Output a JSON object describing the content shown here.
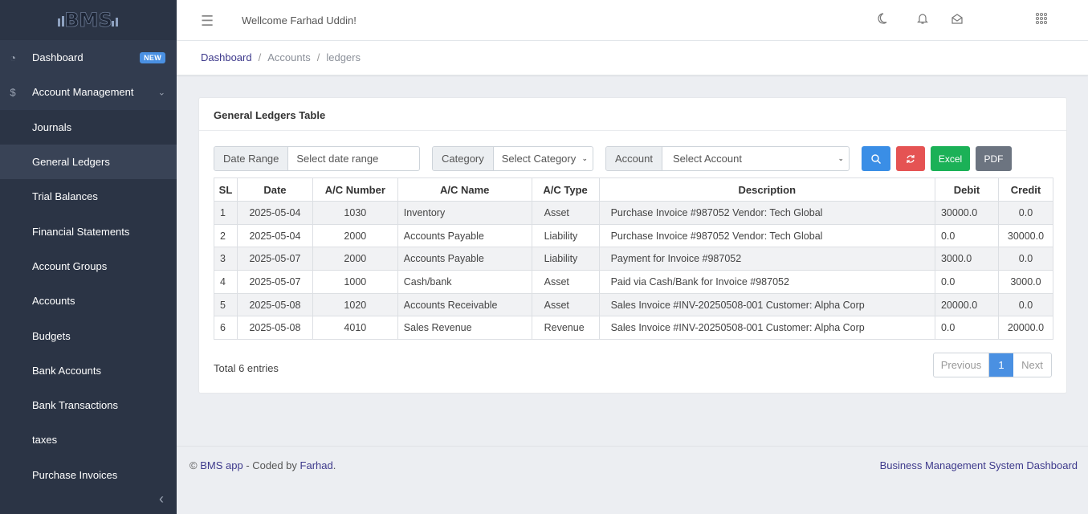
{
  "brand": {
    "logo_text": "BMS"
  },
  "sidebar": {
    "items": [
      {
        "label": "Dashboard",
        "icon": "speedometer-icon",
        "badge": "NEW"
      },
      {
        "label": "Account Management",
        "icon": "dollar-icon",
        "expandable": true
      },
      {
        "label": "Journals"
      },
      {
        "label": "General Ledgers",
        "active": true
      },
      {
        "label": "Trial Balances"
      },
      {
        "label": "Financial Statements"
      },
      {
        "label": "Account Groups"
      },
      {
        "label": "Accounts"
      },
      {
        "label": "Budgets"
      },
      {
        "label": "Bank Accounts"
      },
      {
        "label": "Bank Transactions"
      },
      {
        "label": "taxes"
      },
      {
        "label": "Purchase Invoices"
      }
    ]
  },
  "header": {
    "welcome": "Wellcome Farhad Uddin!"
  },
  "breadcrumb": {
    "items": [
      "Dashboard",
      "Accounts",
      "ledgers"
    ]
  },
  "card": {
    "title": "General Ledgers Table",
    "filters": {
      "date_label": "Date Range",
      "date_placeholder": "Select date range",
      "category_label": "Category",
      "category_value": "Select Category",
      "account_label": "Account",
      "account_value": "Select Account",
      "excel_label": "Excel",
      "pdf_label": "PDF"
    },
    "columns": [
      "SL",
      "Date",
      "A/C Number",
      "A/C Name",
      "A/C Type",
      "Description",
      "Debit",
      "Credit"
    ],
    "rows": [
      [
        "1",
        "2025-05-04",
        "1030",
        "Inventory",
        "Asset",
        "Purchase Invoice #987052 Vendor: Tech Global",
        "30000.0",
        "0.0"
      ],
      [
        "2",
        "2025-05-04",
        "2000",
        "Accounts Payable",
        "Liability",
        "Purchase Invoice #987052 Vendor: Tech Global",
        "0.0",
        "30000.0"
      ],
      [
        "3",
        "2025-05-07",
        "2000",
        "Accounts Payable",
        "Liability",
        "Payment for Invoice #987052",
        "3000.0",
        "0.0"
      ],
      [
        "4",
        "2025-05-07",
        "1000",
        "Cash/bank",
        "Asset",
        "Paid via Cash/Bank for Invoice #987052",
        "0.0",
        "3000.0"
      ],
      [
        "5",
        "2025-05-08",
        "1020",
        "Accounts Receivable",
        "Asset",
        "Sales Invoice #INV-20250508-001 Customer: Alpha Corp",
        "20000.0",
        "0.0"
      ],
      [
        "6",
        "2025-05-08",
        "4010",
        "Sales Revenue",
        "Revenue",
        "Sales Invoice #INV-20250508-001 Customer: Alpha Corp",
        "0.0",
        "20000.0"
      ]
    ],
    "total_text": "Total 6 entries",
    "pagination": {
      "prev": "Previous",
      "current": "1",
      "next": "Next"
    }
  },
  "footer": {
    "copyright": "©",
    "app_link": "BMS app",
    "coded_by": " - Coded by ",
    "author_link": "Farhad",
    "period": ".",
    "right_text": "Business Management System Dashboard"
  },
  "colors": {
    "sidebar_bg": "#2b3445",
    "accent_blue": "#4a90e2",
    "danger": "#e55353",
    "success": "#1bb157",
    "secondary": "#6c7480",
    "link": "#3e3a8c"
  }
}
